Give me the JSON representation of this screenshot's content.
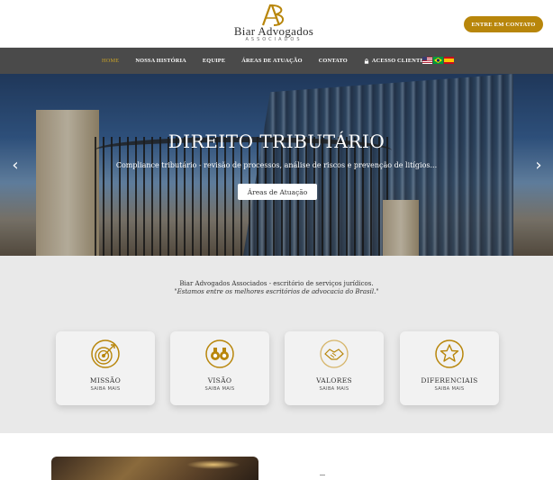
{
  "header": {
    "logo_name": "Biar Advogados",
    "logo_sub": "ASSOCIADOS",
    "cta_label": "ENTRE EM CONTATO"
  },
  "nav": {
    "items": [
      {
        "label": "HOME",
        "active": true
      },
      {
        "label": "NOSSA HISTÓRIA"
      },
      {
        "label": "EQUIPE"
      },
      {
        "label": "ÁREAS DE ATUAÇÃO"
      },
      {
        "label": "CONTATO"
      },
      {
        "label": "ACESSO CLIENTES",
        "icon": "lock-icon"
      }
    ],
    "flags": [
      "us-flag-icon",
      "brazil-flag-icon",
      "spain-flag-icon"
    ]
  },
  "hero": {
    "title": "DIREITO TRIBUTÁRIO",
    "subtitle": "Compliance tributário - revisão de processos, análise de riscos e prevenção de litígios...",
    "button_label": "Áreas de Atuação",
    "prev_icon": "chevron-left-icon",
    "next_icon": "chevron-right-icon"
  },
  "intro": {
    "line1": "Biar Advogados Associados - escritório de serviços jurídicos.",
    "line2": "\"Estamos entre os melhores escritórios de advocacia do Brasil.\""
  },
  "cards": [
    {
      "title": "MISSÃO",
      "link": "SAIBA MAIS",
      "icon": "target-icon"
    },
    {
      "title": "VISÃO",
      "link": "SAIBA MAIS",
      "icon": "binoculars-icon"
    },
    {
      "title": "VALORES",
      "link": "SAIBA MAIS",
      "icon": "handshake-icon"
    },
    {
      "title": "DIFERENCIAIS",
      "link": "SAIBA MAIS",
      "icon": "star-icon"
    }
  ],
  "colors": {
    "gold": "#b8860b",
    "nav_bg": "#4a4a4a",
    "section_bg": "#e9e9e9"
  }
}
